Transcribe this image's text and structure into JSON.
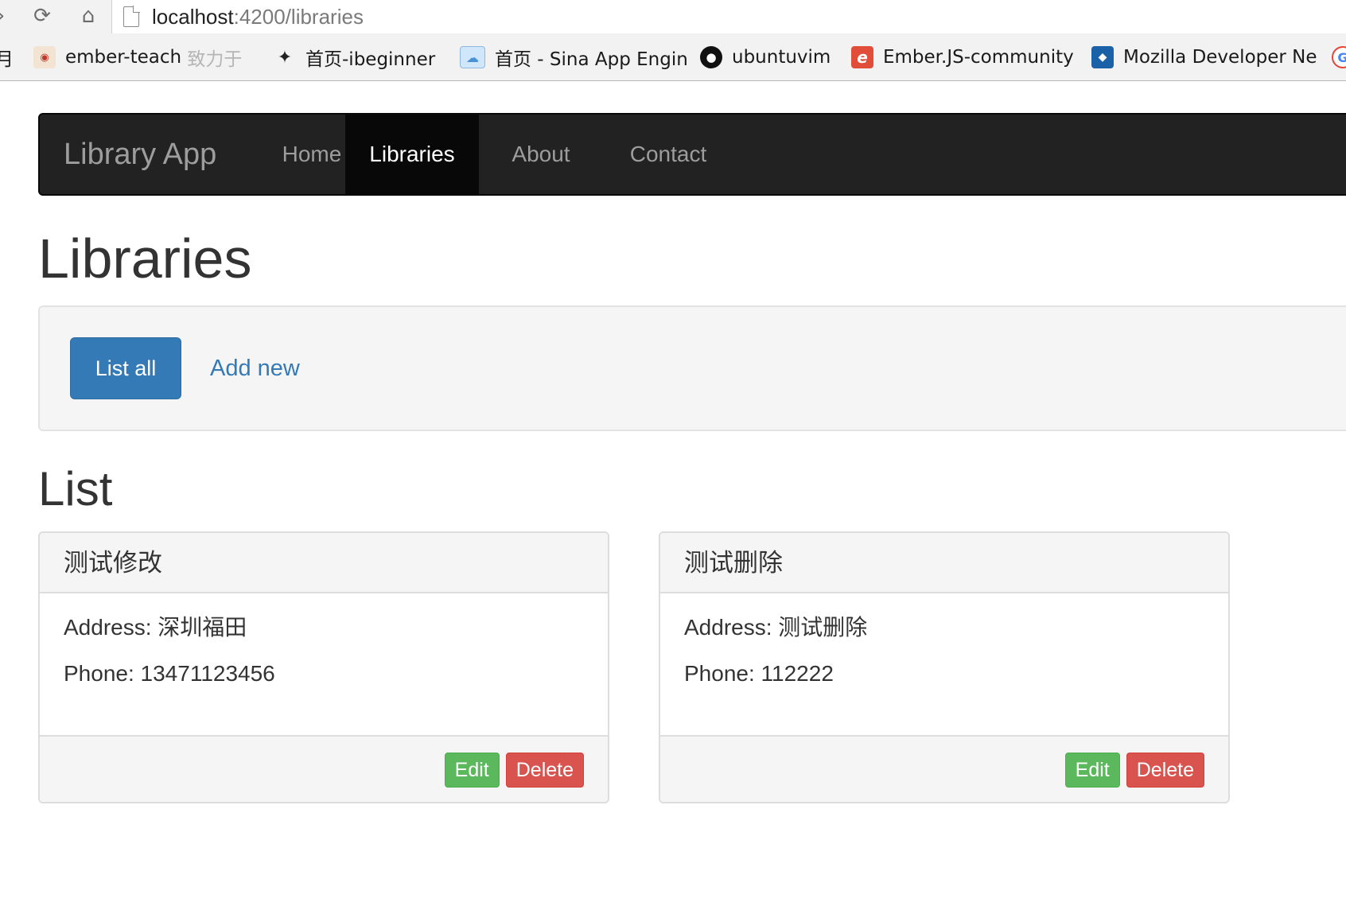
{
  "browser": {
    "url_host": "localhost",
    "url_path": ":4200/libraries",
    "bookmarks": [
      {
        "label": "月",
        "icon": "bookmark-icon"
      },
      {
        "label": "ember-teach",
        "suffix": "致力于",
        "icon": "ember-teach-icon"
      },
      {
        "label": "首页-ibeginner",
        "icon": "bird-icon"
      },
      {
        "label": "首页 - Sina App Engin",
        "icon": "cloud-icon"
      },
      {
        "label": "ubuntuvim",
        "icon": "github-icon"
      },
      {
        "label": "Ember.JS-community",
        "icon": "ember-e-icon"
      },
      {
        "label": "Mozilla Developer Ne",
        "icon": "mdn-icon"
      }
    ]
  },
  "navbar": {
    "brand": "Library App",
    "items": [
      {
        "label": "Home",
        "active": false
      },
      {
        "label": "Libraries",
        "active": true
      },
      {
        "label": "About",
        "active": false
      },
      {
        "label": "Contact",
        "active": false
      }
    ]
  },
  "page": {
    "title": "Libraries",
    "actions": {
      "list_all": "List all",
      "add_new": "Add new"
    },
    "list_title": "List"
  },
  "libraries": [
    {
      "name": "测试修改",
      "address_label": "Address:",
      "address": "深圳福田",
      "phone_label": "Phone:",
      "phone": "13471123456",
      "edit_label": "Edit",
      "delete_label": "Delete"
    },
    {
      "name": "测试删除",
      "address_label": "Address:",
      "address": "测试删除",
      "phone_label": "Phone:",
      "phone": "112222",
      "edit_label": "Edit",
      "delete_label": "Delete"
    }
  ],
  "colors": {
    "navbar_bg": "#222222",
    "navbar_active": "#080808",
    "primary": "#337ab7",
    "success": "#5cb85c",
    "danger": "#d9534f"
  }
}
